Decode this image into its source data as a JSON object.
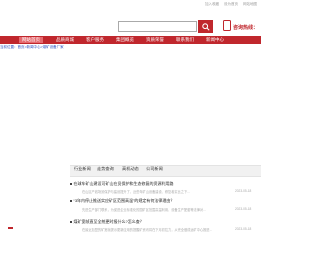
{
  "top_links": [
    "加入收藏",
    "设为首页",
    "网站地图"
  ],
  "header": {
    "hotline_label": "咨询热线：",
    "search_placeholder": ""
  },
  "nav": {
    "items": [
      "网站首页",
      "品质商城",
      "客户服务",
      "集团概览",
      "资质荣誉",
      "联系我们",
      "新闻中心"
    ],
    "active_index": 0
  },
  "breadcrumb": "当前位置：首页>新闻中心>煤矿设备厂家",
  "news": {
    "tabs": [
      "行业新闻",
      "走势查询",
      "高机动态",
      "公司新闻"
    ],
    "items": [
      {
        "title": "在球车矿山建设可矿山在员保护和生态修复的资源利用路",
        "summary": "在山区产线场景保护与建设提升了，近些年矿山设备建设、修复着实比之下...",
        "date": "2023-05-18"
      },
      {
        "title": "“3年内停止推送实应矿区范围高温”的规定有何法律理由？",
        "summary": "先进生产部门联系，为促进企业标准化的国矿区范围高温利用、设备生产配套等法律对...",
        "date": "2023-05-18"
      },
      {
        "title": "煤矿宽帧直至全统更时报什么?怎么查？",
        "summary": "在最近加盟的矿宽帧提示更新应用的提醒矿资讯将在下月初拉力，从完全做成运矿中心推进...",
        "date": "2023-05-18"
      }
    ]
  },
  "colors": {
    "brand_red": "#c0272d",
    "active_nav": "#e56a6f",
    "breadcrumb_blue": "#2a4fbf"
  }
}
